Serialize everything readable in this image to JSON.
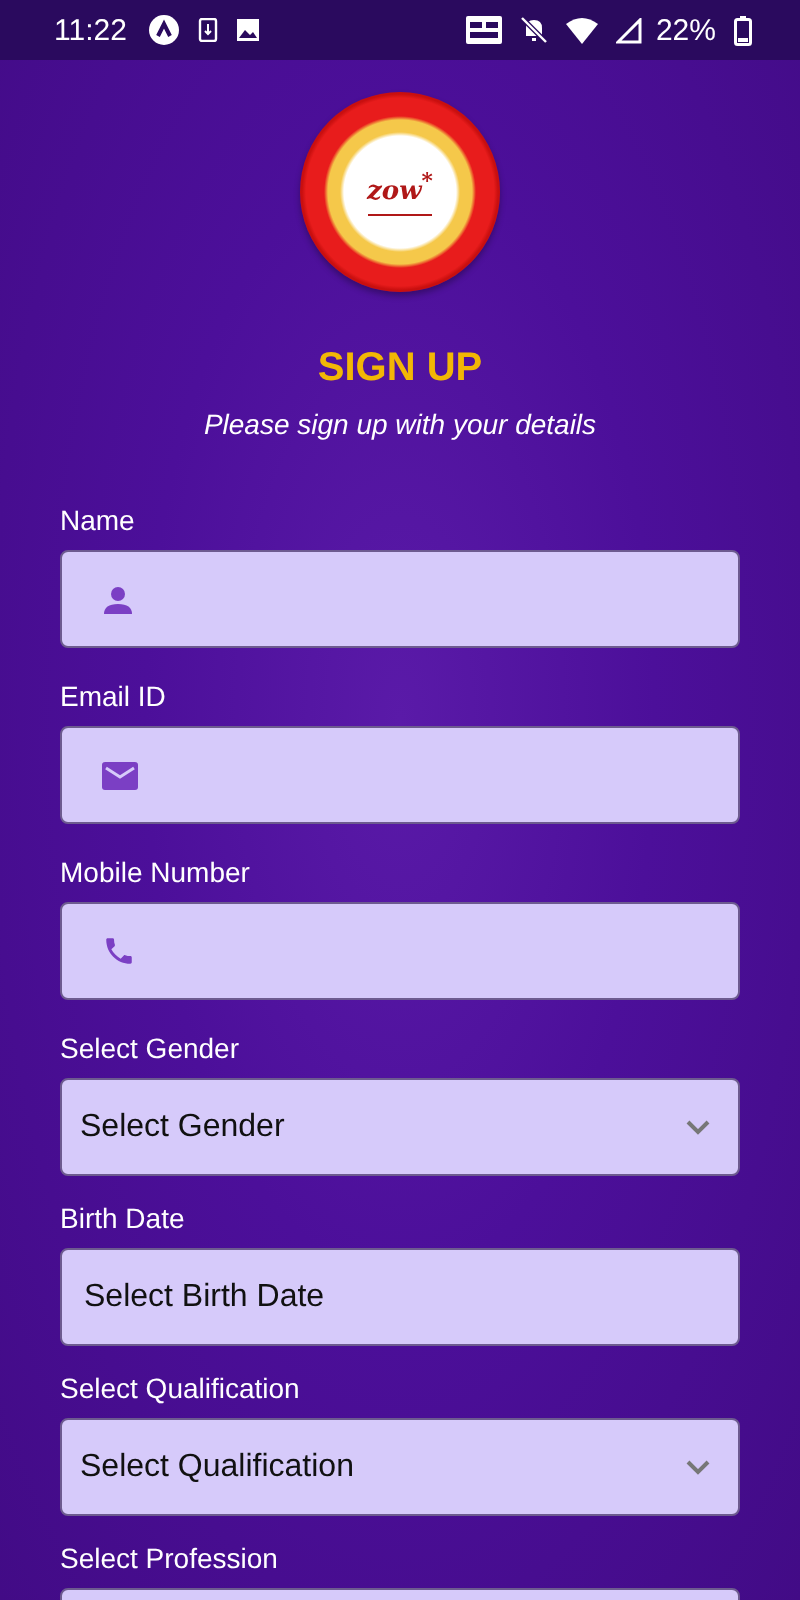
{
  "status_bar": {
    "time": "11:22",
    "battery": "22%"
  },
  "logo": {
    "text": "zow$^{*}$"
  },
  "title": "SIGN UP",
  "subtitle": "Please sign up with your details",
  "fields": [
    {
      "kind": "icon",
      "label": "Name"
    },
    {
      "kind": "icon",
      "label": "Email ID"
    },
    {
      "kind": "icon",
      "label": "Mobile Number"
    },
    {
      "kind": "select",
      "label": "Select Gender",
      "value": "Select Gender"
    },
    {
      "kind": "date",
      "label": "Birth Date",
      "value": "Select Birth Date"
    },
    {
      "kind": "select",
      "label": "Select Qualification",
      "value": "Select Qualification"
    },
    {
      "kind": "cut",
      "label": "Select Profession"
    }
  ]
}
